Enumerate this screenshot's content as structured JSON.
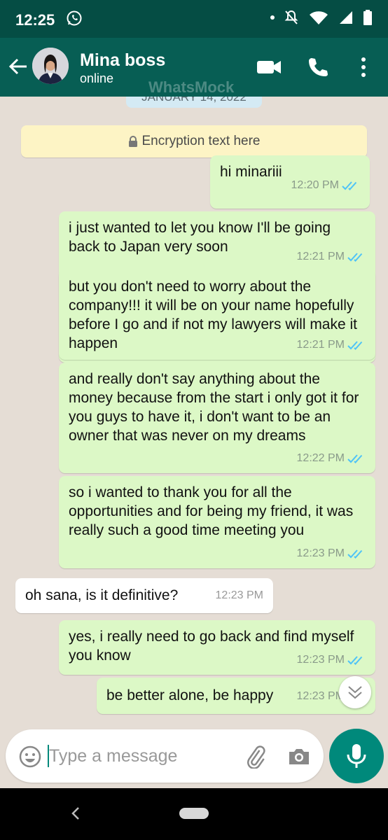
{
  "status_bar": {
    "time": "12:25"
  },
  "header": {
    "contact_name": "Mina boss",
    "contact_status": "online",
    "watermark": "WhatsMock"
  },
  "date_chip": "JANUARY 14, 2022",
  "encryption_notice": "Encryption text here",
  "messages": [
    {
      "direction": "out",
      "text": "hi minariii",
      "time": "12:20 PM"
    },
    {
      "direction": "out",
      "text": "i just wanted to let you know I'll be going back to Japan very soon",
      "time": "12:21 PM"
    },
    {
      "direction": "out",
      "text": "but you don't need to worry about the company!!! it will be on your name hopefully before I go and if not my lawyers will make it happen",
      "time": "12:21 PM"
    },
    {
      "direction": "out",
      "text": "and really don't say anything about the money because from the start i only got it for you guys to have it, i don't want to be an owner that was never on my dreams",
      "time": "12:22 PM"
    },
    {
      "direction": "out",
      "text": "so i wanted to thank you for all the opportunities and for being my friend, it was really such a good time meeting you",
      "time": "12:23 PM"
    },
    {
      "direction": "in",
      "text": "oh sana, is it definitive?",
      "time": "12:23 PM"
    },
    {
      "direction": "out",
      "text": "yes, i really need to go back and find myself you know",
      "time": "12:23 PM"
    },
    {
      "direction": "out",
      "text": "be better alone, be happy",
      "time": "12:23 PM"
    }
  ],
  "composer": {
    "placeholder": "Type a message"
  },
  "colors": {
    "header": "#075e54",
    "status_bar": "#054d44",
    "outgoing_bubble": "#dcf8c6",
    "incoming_bubble": "#ffffff",
    "chat_bg": "#e5ddd5",
    "accent": "#00897b",
    "read_ticks": "#4fc3f7"
  },
  "icons": [
    "whatsapp-icon",
    "dnd-icon",
    "wifi-icon",
    "signal-icon",
    "battery-icon",
    "back-arrow-icon",
    "video-call-icon",
    "phone-icon",
    "more-vert-icon",
    "lock-icon",
    "double-check-icon",
    "chevron-double-down-icon",
    "emoji-icon",
    "attach-icon",
    "camera-icon",
    "mic-icon",
    "nav-back-icon"
  ]
}
